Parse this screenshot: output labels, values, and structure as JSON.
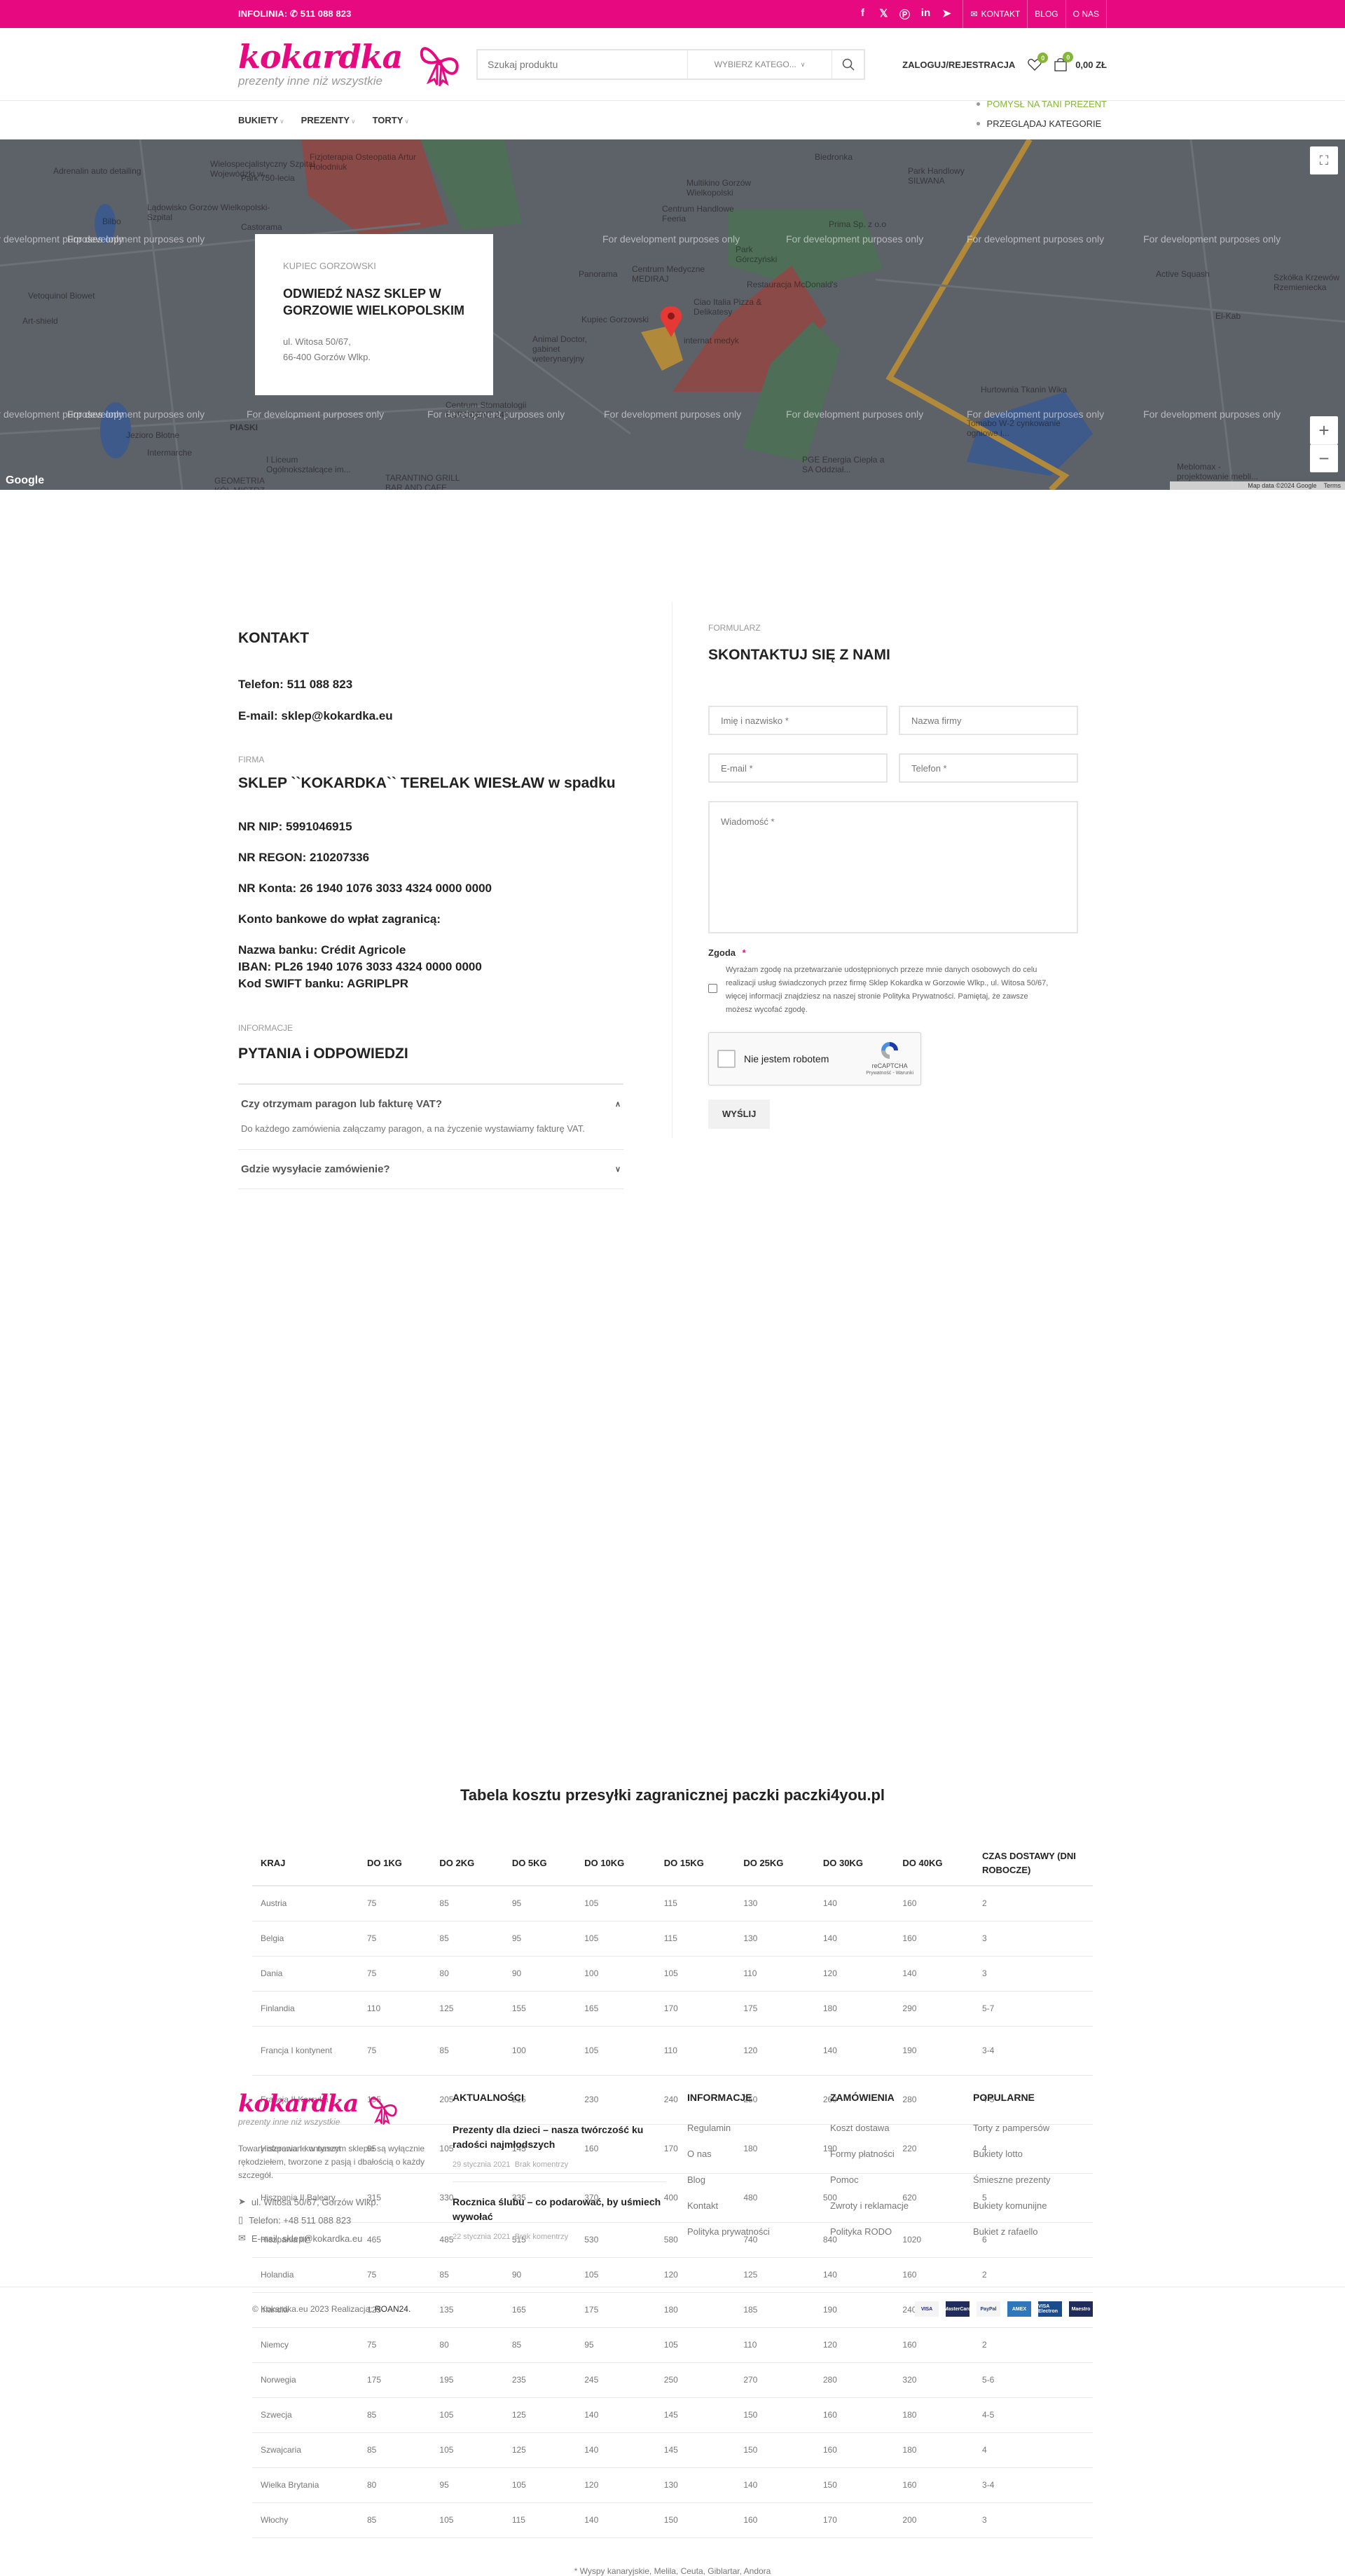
{
  "topbar": {
    "infolinia_label": "INFOLINIA:",
    "phone": "511 088 823",
    "social": [
      "facebook-icon",
      "x-icon",
      "pinterest-icon",
      "linkedin-icon",
      "telegram-icon"
    ],
    "links": {
      "contact": "KONTAKT",
      "blog": "BLOG",
      "about": "O NAS"
    }
  },
  "header": {
    "logo_main": "kokardka",
    "logo_sub": "prezenty inne niż wszystkie",
    "search_placeholder": "Szukaj produktu",
    "category_select": "WYBIERZ KATEGO...",
    "login": "ZALOGUJ/REJESTRACJA",
    "wishlist_count": "0",
    "cart_count": "0",
    "cart_total": "0,00 ZŁ"
  },
  "nav": {
    "items": [
      {
        "label": "BUKIETY"
      },
      {
        "label": "PREZENTY"
      },
      {
        "label": "TORTY"
      }
    ],
    "extra": [
      "POMYSŁ NA TANI PREZENT",
      "PRZEGLĄDAJ KATEGORIE"
    ]
  },
  "map": {
    "watermark": "For development purposes only",
    "labels": [
      "Adrenalin auto detailing",
      "Bilbo",
      "Wielospecjalistyczny Szpital Wojewódzki w...",
      "Park 750-lecia",
      "Lądowisko Gorzów Wielkopolski-Szpital",
      "Castorama",
      "Fizjoterapia Osteopatia Artur Hołodniuk",
      "Multikino Gorzów Wielkopolski",
      "Centrum Handlowe Feeria",
      "Biedronka",
      "Park Handlowy SILWANA",
      "Prima Sp. z o.o",
      "Panorama",
      "Centrum Medyczne MEDIRAJ",
      "Park Górczyński",
      "Restauracja McDonald's",
      "Ciao Italia Pizza & Delikatesy",
      "Kupiec Gorzowski",
      "internat medyk",
      "Animal Doctor, gabinet weterynaryjny",
      "Vetoquinol Biowet",
      "Art-shield",
      "Active Squash",
      "Szkółka Krzewów Rzemieniecka",
      "El-Kab",
      "Centrum Stomatologii EURODENT 24h",
      "PIASKI",
      "Jezioro Błotne",
      "Intermarche",
      "I Liceum Ogólnokształcące im...",
      "TARANTINO GRILL BAR AND CAFE",
      "GEOMETRIA KÓŁ MISTRZ",
      "Hurtownia Tkanin Wika",
      "Tomabo W-2 cynkowanie ogniowe i...",
      "PGE Energia Ciepła a SA Oddział...",
      "Meblomax - projektowanie mebli..."
    ],
    "attribution": "Map data ©2024 Google",
    "terms": "Terms",
    "google": "Google",
    "card": {
      "overline": "KUPIEC GORZOWSKI",
      "title": "ODWIEDŹ NASZ SKLEP W GORZOWIE WIELKOPOLSKIM",
      "address1": "ul. Witosa 50/67,",
      "address2": "66-400 Gorzów Wlkp."
    }
  },
  "contact": {
    "title": "KONTAKT",
    "phone": "Telefon: 511 088 823",
    "email": "E-mail: sklep@kokardka.eu",
    "firm_overline": "FIRMA",
    "firm_name": "SKLEP ``KOKARDKA`` TERELAK WIESŁAW w spadku",
    "nip": "NR NIP: 5991046915",
    "regon": "NR REGON: 210207336",
    "konto": "NR Konta: 26 1940 1076 3033 4324 0000 0000",
    "foreign_label": "Konto bankowe do wpłat zagranicą:",
    "bank_name": "Nazwa banku: Crédit Agricole",
    "iban": "IBAN: PL26 1940 1076 3033 4324 0000 0000",
    "swift": "Kod SWIFT banku: AGRIPLPR",
    "info_overline": "INFORMACJE",
    "faq_title": "PYTANIA i ODPOWIEDZI",
    "faq": [
      {
        "q": "Czy otrzymam paragon lub fakturę VAT?",
        "a": "Do każdego zamówienia załączamy paragon, a na życzenie wystawiamy fakturę VAT.",
        "open": true
      },
      {
        "q": "Gdzie wysyłacie zamówienie?",
        "a": "",
        "open": false
      }
    ]
  },
  "form": {
    "overline": "FORMULARZ",
    "title": "SKONTAKTUJ SIĘ Z NAMI",
    "name_ph": "Imię i nazwisko *",
    "company_ph": "Nazwa firmy",
    "email_ph": "E-mail *",
    "phone_ph": "Telefon *",
    "message_ph": "Wiadomość *",
    "consent_label": "Zgoda",
    "consent_required": "*",
    "consent_text": "Wyrażam zgodę na przetwarzanie udostępnionych przeze mnie danych osobowych do celu realizacji usług świadczonych przez firmę Sklep Kokardka w Gorzowie Wlkp., ul. Witosa 50/67, więcej informacji znajdziesz na naszej stronie Polityka Prywatności. Pamiętaj, że zawsze możesz wycofać zgodę.",
    "captcha_label": "Nie jestem robotem",
    "captcha_brand": "reCAPTCHA",
    "captcha_links": "Prywatność - Warunki",
    "submit": "WYŚLIJ"
  },
  "shipping": {
    "title": "Tabela kosztu przesyłki zagranicznej paczki paczki4you.pl",
    "headers": [
      "KRAJ",
      "DO 1KG",
      "DO 2KG",
      "DO 5KG",
      "DO 10KG",
      "DO 15KG",
      "DO 25KG",
      "DO 30KG",
      "DO 40KG",
      "CZAS DOSTAWY (DNI ROBOCZE)"
    ],
    "rows": [
      [
        "Austria",
        "75",
        "85",
        "95",
        "105",
        "115",
        "130",
        "140",
        "160",
        "2"
      ],
      [
        "Belgia",
        "75",
        "85",
        "95",
        "105",
        "115",
        "130",
        "140",
        "160",
        "3"
      ],
      [
        "Dania",
        "75",
        "80",
        "90",
        "100",
        "105",
        "110",
        "120",
        "140",
        "3"
      ],
      [
        "Finlandia",
        "110",
        "125",
        "155",
        "165",
        "170",
        "175",
        "180",
        "290",
        "5-7"
      ],
      [
        "Francja I kontynent",
        "75",
        "85",
        "100",
        "105",
        "110",
        "120",
        "140",
        "190",
        "3-4"
      ],
      [
        "Francja II Korsyka",
        "195",
        "205",
        "215",
        "230",
        "240",
        "250",
        "260",
        "280",
        "4-5"
      ],
      [
        "Hiszpania I kontynent",
        "95",
        "105",
        "145",
        "160",
        "170",
        "180",
        "190",
        "220",
        "4"
      ],
      [
        "Hiszpania II Baleary",
        "315",
        "330",
        "335",
        "370",
        "400",
        "480",
        "500",
        "620",
        "5"
      ],
      [
        "Hiszpania III*",
        "465",
        "485",
        "515",
        "530",
        "580",
        "740",
        "840",
        "1020",
        "6"
      ],
      [
        "Holandia",
        "75",
        "85",
        "90",
        "105",
        "120",
        "125",
        "140",
        "160",
        "2"
      ],
      [
        "Irlandia",
        "125",
        "135",
        "165",
        "175",
        "180",
        "185",
        "190",
        "240",
        "4"
      ],
      [
        "Niemcy",
        "75",
        "80",
        "85",
        "95",
        "105",
        "110",
        "120",
        "160",
        "2"
      ],
      [
        "Norwegia",
        "175",
        "195",
        "235",
        "245",
        "250",
        "270",
        "280",
        "320",
        "5-6"
      ],
      [
        "Szwecja",
        "85",
        "105",
        "125",
        "140",
        "145",
        "150",
        "160",
        "180",
        "4-5"
      ],
      [
        "Szwajcaria",
        "85",
        "105",
        "125",
        "140",
        "145",
        "150",
        "160",
        "180",
        "4"
      ],
      [
        "Wielka Brytania",
        "80",
        "95",
        "105",
        "120",
        "130",
        "140",
        "150",
        "160",
        "3-4"
      ],
      [
        "Włochy",
        "85",
        "105",
        "115",
        "140",
        "150",
        "160",
        "170",
        "200",
        "3"
      ]
    ],
    "note": "* Wyspy kanaryjskie, Melila, Ceuta, Giblartar, Andora"
  },
  "footer": {
    "about": "Towary oferowane w naszym sklepie są wyłącznie rękodziełem, tworzone z pasją i dbałością o każdy szczegół.",
    "address": "ul. Witosa 50/67, Gorzów Wlkp.",
    "phone": "Telefon: +48 511 088 823",
    "email": "E-mail: sklep@kokardka.eu",
    "news_title": "AKTUALNOŚCI",
    "posts": [
      {
        "title": "Prezenty dla dzieci – nasza twórczość ku radości najmłodszych",
        "date": "29 stycznia 2021",
        "comments": "Brak komentrzy"
      },
      {
        "title": "Rocznica ślubu – co podarować, by uśmiech wywołać",
        "date": "22 stycznia 2021",
        "comments": "Brak komentrzy"
      }
    ],
    "columns": [
      {
        "title": "INFORMACJE",
        "links": [
          "Regulamin",
          "O nas",
          "Blog",
          "Kontakt",
          "Polityka prywatności"
        ]
      },
      {
        "title": "ZAMÓWIENIA",
        "links": [
          "Koszt dostawa",
          "Formy płatności",
          "Pomoc",
          "Zwroty i reklamacje",
          "Polityka RODO"
        ]
      },
      {
        "title": "POPULARNE",
        "links": [
          "Torty z pampersów",
          "Bukiety lotto",
          "Śmieszne prezenty",
          "Bukiety komunijne",
          "Bukiet z rafaello"
        ]
      }
    ],
    "copyright": "© Kokardka.eu 2023 Realizacja:",
    "credit": "ROAN24.",
    "payments": [
      {
        "name": "VISA",
        "color": "#f4f4f4",
        "text": "#1a1f71"
      },
      {
        "name": "MasterCard",
        "color": "#1f2c5c",
        "text": "#ffffff"
      },
      {
        "name": "PayPal",
        "color": "#f4f4f4",
        "text": "#253b80"
      },
      {
        "name": "AMEX",
        "color": "#2e77bb",
        "text": "#ffffff"
      },
      {
        "name": "VISA Electron",
        "color": "#1a4b8c",
        "text": "#ffffff"
      },
      {
        "name": "Maestro",
        "color": "#1f2c5c",
        "text": "#ffffff"
      }
    ]
  },
  "colors": {
    "brand": "#e6097f",
    "accent_green": "#83b735"
  }
}
